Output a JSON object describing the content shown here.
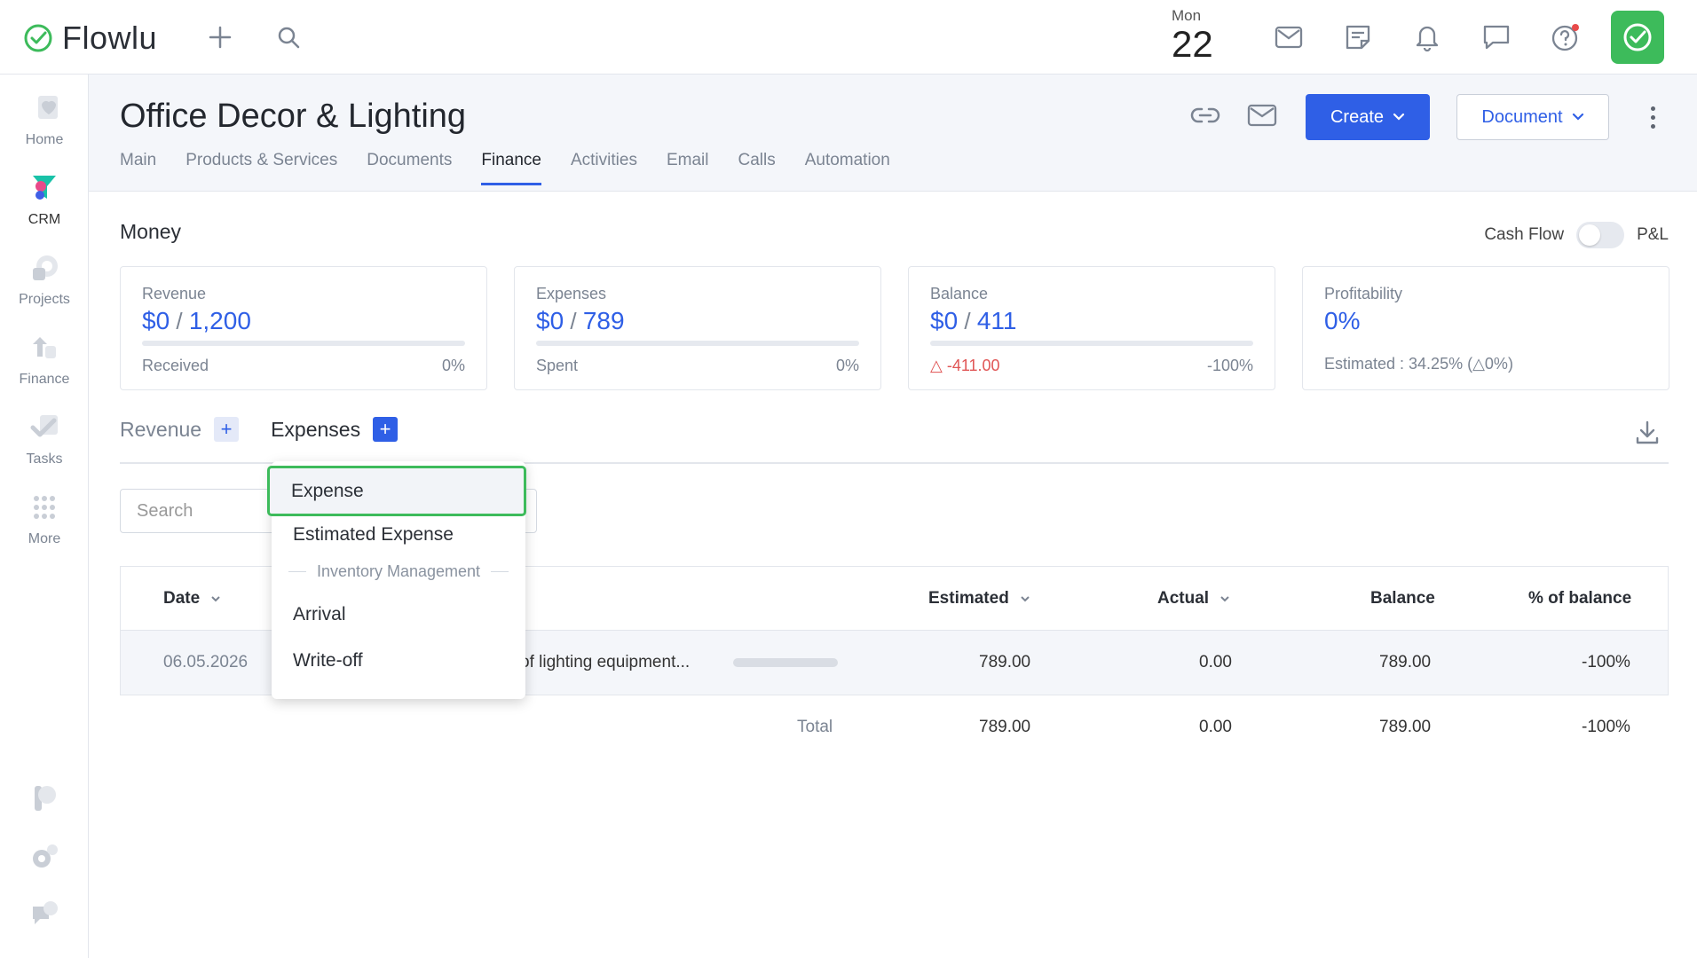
{
  "app": {
    "brand": "Flowlu",
    "brand_color": "#3dbb5b",
    "accent": "#2f5fe6"
  },
  "date": {
    "day": "Mon",
    "num": "22"
  },
  "sidebar": {
    "items": [
      {
        "label": "Home",
        "icon": "heart-icon"
      },
      {
        "label": "CRM",
        "icon": "funnel-icon"
      },
      {
        "label": "Projects",
        "icon": "projects-icon"
      },
      {
        "label": "Finance",
        "icon": "finance-icon"
      },
      {
        "label": "Tasks",
        "icon": "check-icon"
      },
      {
        "label": "More",
        "icon": "grid-dots-icon"
      }
    ]
  },
  "page": {
    "title": "Office Decor & Lighting",
    "tabs": [
      "Main",
      "Products & Services",
      "Documents",
      "Finance",
      "Activities",
      "Email",
      "Calls",
      "Automation"
    ],
    "active_tab": "Finance",
    "create_label": "Create",
    "document_label": "Document"
  },
  "money": {
    "title": "Money",
    "toggle_left": "Cash Flow",
    "toggle_right": "P&L",
    "cards": [
      {
        "label": "Revenue",
        "actual": "$0",
        "total": "1,200",
        "foot_left": "Received",
        "foot_right": "0%",
        "progress": 0
      },
      {
        "label": "Expenses",
        "actual": "$0",
        "total": "789",
        "foot_left": "Spent",
        "foot_right": "0%",
        "progress": 0
      },
      {
        "label": "Balance",
        "actual": "$0",
        "total": "411",
        "foot_left": "-411.00",
        "foot_right": "-100%",
        "progress": 0
      },
      {
        "label": "Profitability",
        "value": "0%",
        "foot": "Estimated : 34.25% (△0%)"
      }
    ]
  },
  "subtabs": {
    "revenue": "Revenue",
    "expenses": "Expenses"
  },
  "search": {
    "placeholder": "Search"
  },
  "table": {
    "headers": {
      "date": "Date",
      "estimated": "Estimated",
      "actual": "Actual",
      "balance": "Balance",
      "percent": "% of balance"
    },
    "row": {
      "date": "06.05.2026",
      "name": "of lighting equipment...",
      "estimated": "789.00",
      "actual": "0.00",
      "balance": "789.00",
      "percent": "-100%"
    },
    "total": {
      "label": "Total",
      "estimated": "789.00",
      "actual": "0.00",
      "balance": "789.00",
      "percent": "-100%"
    }
  },
  "dropdown": {
    "items": [
      "Expense",
      "Estimated Expense",
      "Arrival",
      "Write-off"
    ],
    "section": "Inventory Management"
  }
}
